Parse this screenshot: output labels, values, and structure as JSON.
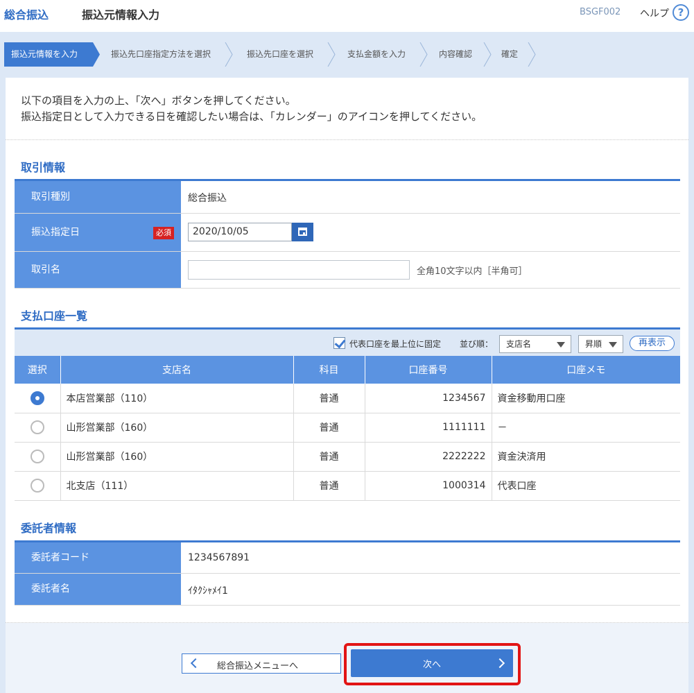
{
  "header": {
    "app_title": "総合振込",
    "page_title": "振込元情報入力",
    "screen_code": "BSGF002",
    "help_label": "ヘルプ",
    "help_glyph": "?"
  },
  "steps": [
    {
      "label": "振込元情報を入力",
      "active": true
    },
    {
      "label": "振込先口座指定方法を選択",
      "active": false
    },
    {
      "label": "振込先口座を選択",
      "active": false
    },
    {
      "label": "支払金額を入力",
      "active": false
    },
    {
      "label": "内容確認",
      "active": false
    },
    {
      "label": "確定",
      "active": false
    }
  ],
  "instructions": {
    "line1": "以下の項目を入力の上、「次へ」ボタンを押してください。",
    "line2": "振込指定日として入力できる日を確認したい場合は、「カレンダー」のアイコンを押してください。"
  },
  "transaction": {
    "title": "取引情報",
    "type_label": "取引種別",
    "type_value": "総合振込",
    "date_label": "振込指定日",
    "required_badge": "必須",
    "date_value": "2020/10/05",
    "name_label": "取引名",
    "name_value": "",
    "name_hint": "全角10文字以内［半角可］"
  },
  "accounts": {
    "title": "支払口座一覧",
    "pin_label": "代表口座を最上位に固定",
    "sort_label": "並び順：",
    "sort_key": "支店名",
    "sort_order": "昇順",
    "redisplay_label": "再表示",
    "columns": [
      "選択",
      "支店名",
      "科目",
      "口座番号",
      "口座メモ"
    ],
    "rows": [
      {
        "selected": true,
        "branch": "本店営業部（110）",
        "type": "普通",
        "number": "1234567",
        "memo": "資金移動用口座"
      },
      {
        "selected": false,
        "branch": "山形営業部（160）",
        "type": "普通",
        "number": "1111111",
        "memo": "－"
      },
      {
        "selected": false,
        "branch": "山形営業部（160）",
        "type": "普通",
        "number": "2222222",
        "memo": "資金決済用"
      },
      {
        "selected": false,
        "branch": "北支店（111）",
        "type": "普通",
        "number": "1000314",
        "memo": "代表口座"
      }
    ]
  },
  "consignor": {
    "title": "委託者情報",
    "code_label": "委託者コード",
    "code_value": "1234567891",
    "name_label": "委託者名",
    "name_value": "ｲﾀｸｼｬﾒｲ1"
  },
  "footer": {
    "back_label": "総合振込メニューへ",
    "next_label": "次へ"
  },
  "colors": {
    "accent": "#3d7ad1",
    "header_cell": "#5b93e1",
    "required": "#d62222",
    "highlight": "#e21414"
  }
}
